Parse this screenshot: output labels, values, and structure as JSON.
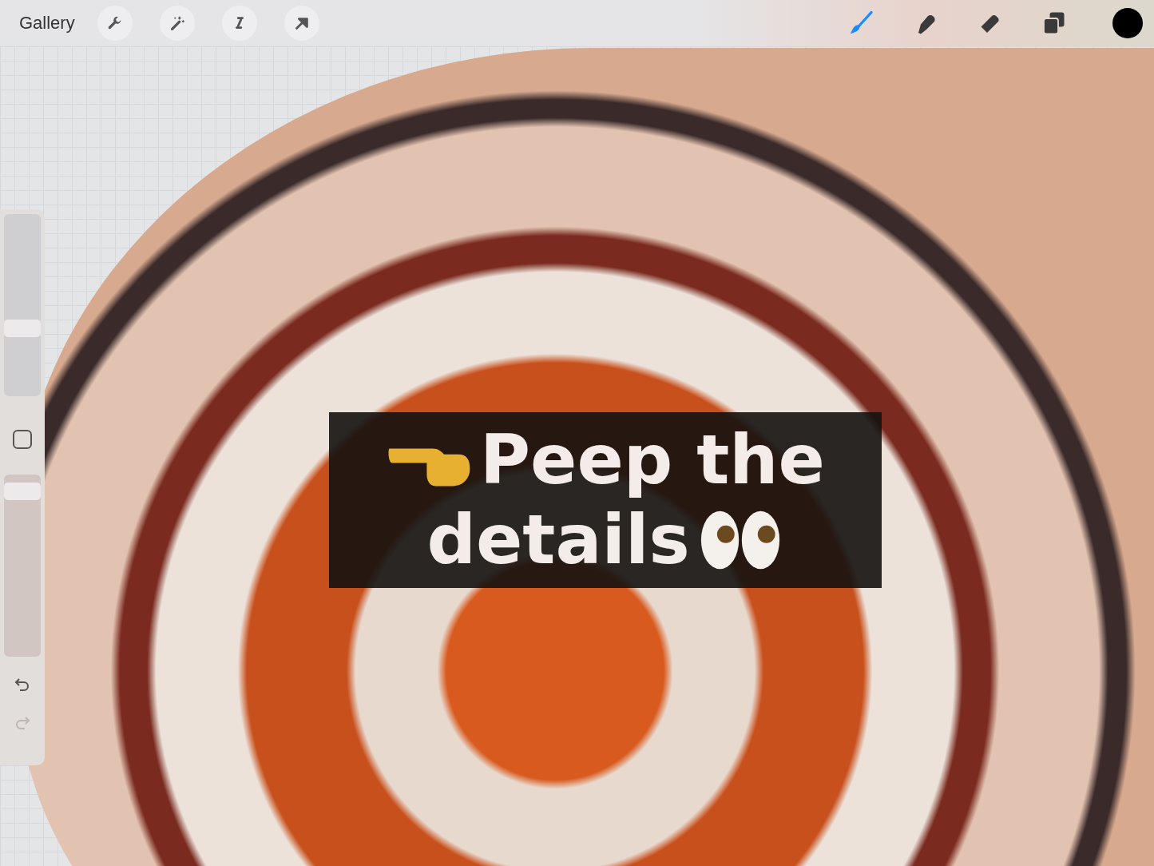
{
  "toolbar": {
    "gallery": "Gallery",
    "actions": [
      {
        "kind": "wrench"
      },
      {
        "kind": "wand"
      },
      {
        "kind": "selection"
      },
      {
        "kind": "transform"
      }
    ],
    "tools": [
      {
        "kind": "brush",
        "selected": true
      },
      {
        "kind": "smudge",
        "selected": false
      },
      {
        "kind": "eraser",
        "selected": false
      },
      {
        "kind": "layers",
        "selected": false
      }
    ],
    "color": {
      "color": "#000000"
    }
  },
  "sidebar": {
    "size": {
      "level": 0.36
    },
    "opacity": {
      "level": 0.95
    },
    "undo": {
      "disabled": false
    },
    "redo": {
      "disabled": true
    }
  },
  "caption": {
    "line_1": "Peep the",
    "line_2": "details"
  }
}
